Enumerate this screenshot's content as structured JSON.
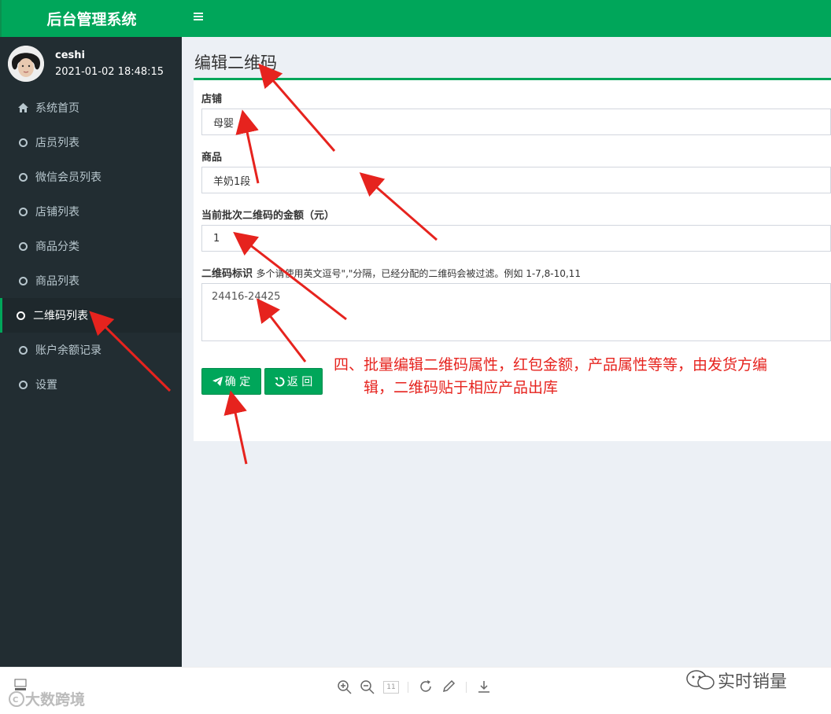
{
  "app": {
    "title": "后台管理系统"
  },
  "user": {
    "name": "ceshi",
    "time": "2021-01-02 18:48:15"
  },
  "sidebar": {
    "items": [
      {
        "label": "系统首页",
        "icon": "home-icon"
      },
      {
        "label": "店员列表",
        "icon": "circle-icon"
      },
      {
        "label": "微信会员列表",
        "icon": "circle-icon"
      },
      {
        "label": "店铺列表",
        "icon": "circle-icon"
      },
      {
        "label": "商品分类",
        "icon": "circle-icon"
      },
      {
        "label": "商品列表",
        "icon": "circle-icon"
      },
      {
        "label": "二维码列表",
        "icon": "circle-icon",
        "active": true
      },
      {
        "label": "账户余额记录",
        "icon": "circle-icon"
      },
      {
        "label": "设置",
        "icon": "circle-icon"
      }
    ]
  },
  "page": {
    "title": "编辑二维码"
  },
  "form": {
    "shop_label": "店铺",
    "shop_value": "母婴",
    "product_label": "商品",
    "product_value": "羊奶1段",
    "amount_label": "当前批次二维码的金额（元）",
    "amount_value": "1",
    "qrcode_label": "二维码标识",
    "qrcode_hint": "多个请使用英文逗号\",\"分隔，已经分配的二维码会被过滤。例如 1-7,8-10,11",
    "qrcode_value": "24416-24425",
    "confirm_label": "确 定",
    "back_label": "返 回"
  },
  "annotation": {
    "line1": "四、批量编辑二维码属性，红包金额，产品属性等等，由发货方编",
    "line2": "辑，二维码贴于相应产品出库"
  },
  "viewer": {
    "page_indicator": "11",
    "watermark_left": "大数跨境",
    "watermark_right": "实时销量"
  },
  "colors": {
    "brand_green": "#00a65a",
    "sidebar_bg": "#222d32",
    "annotation_red": "#e6231e"
  }
}
